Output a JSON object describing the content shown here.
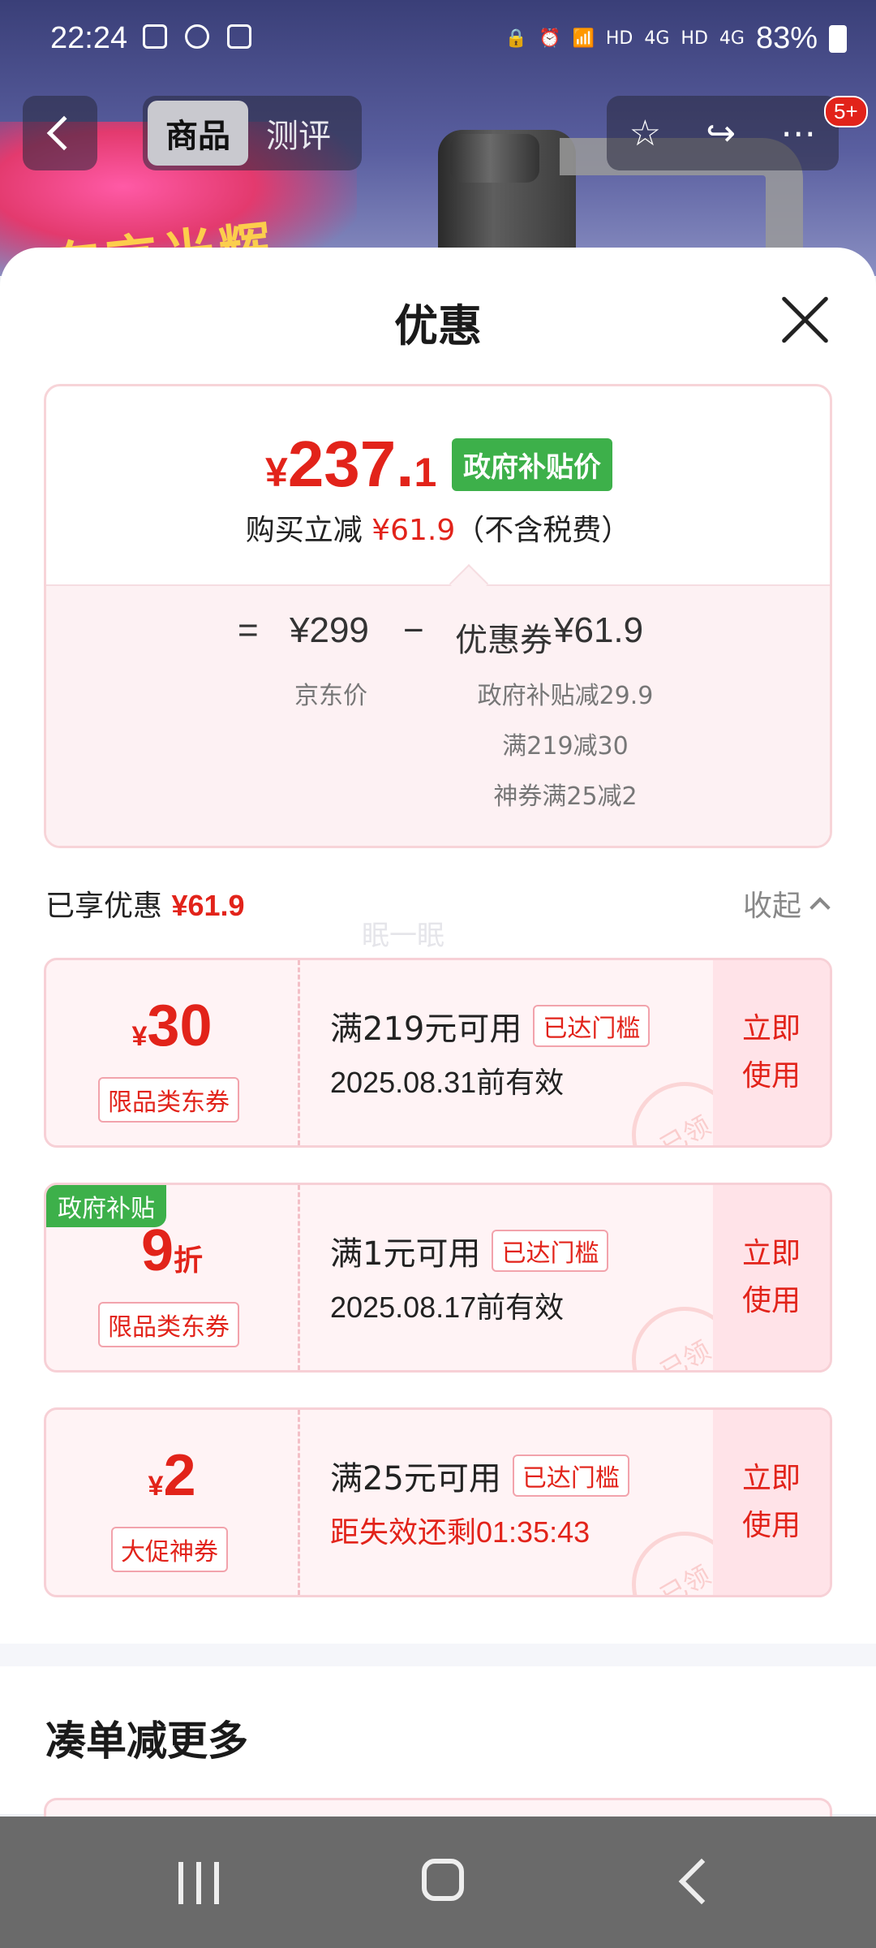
{
  "status_bar": {
    "time": "22:24",
    "network_labels": [
      "HD",
      "4G",
      "HD",
      "4G"
    ],
    "battery_percent": "83%"
  },
  "top_nav": {
    "tabs": [
      {
        "label": "商品",
        "active": true
      },
      {
        "label": "测评",
        "active": false
      }
    ],
    "message_badge": "5+",
    "icons": [
      "back-icon",
      "star-icon",
      "share-icon",
      "more-icon"
    ]
  },
  "background_banner": {
    "text": "东京光辉"
  },
  "sheet": {
    "title": "优惠",
    "summary": {
      "price_yen": "¥",
      "price_int": "237.",
      "price_dec": "1",
      "gov_tag": "政府补贴价",
      "buy_prefix": "购买立减",
      "buy_amount": "¥61.9",
      "buy_suffix": "（不含税费）",
      "formula": {
        "equals": "=",
        "base_price": "¥299",
        "minus": "−",
        "coupon_label": "优惠券",
        "coupon_amount": "¥61.9"
      },
      "base_price_label": "京东价",
      "coupon_details": [
        "政府补贴减29.9",
        "满219减30",
        "神券满25减2"
      ]
    },
    "enjoyed": {
      "label": "已享优惠",
      "amount": "¥61.9",
      "collapse_label": "收起"
    },
    "watermark": "眠一眠",
    "coupons": [
      {
        "corner_tag": "",
        "currency": "¥",
        "amount": "30",
        "unit": "",
        "type": "限品类东券",
        "condition": "满219元可用",
        "reach_tag": "已达门槛",
        "validity": "2025.08.31前有效",
        "validity_highlight": false,
        "stamp": "已领",
        "action": "立即\n使用"
      },
      {
        "corner_tag": "政府补贴",
        "currency": "",
        "amount": "9",
        "unit": "折",
        "type": "限品类东券",
        "condition": "满1元可用",
        "reach_tag": "已达门槛",
        "validity": "2025.08.17前有效",
        "validity_highlight": false,
        "stamp": "已领",
        "action": "立即\n使用"
      },
      {
        "corner_tag": "",
        "currency": "¥",
        "amount": "2",
        "unit": "",
        "type": "大促神券",
        "condition": "满25元可用",
        "reach_tag": "已达门槛",
        "validity": "距失效还剩01:35:43",
        "validity_highlight": true,
        "stamp": "已领",
        "action": "立即\n使用"
      }
    ],
    "more_title": "凑单减更多"
  },
  "colors": {
    "accent_red": "#e2231a",
    "gov_green": "#3db04a",
    "coupon_bg": "#fff3f5"
  }
}
